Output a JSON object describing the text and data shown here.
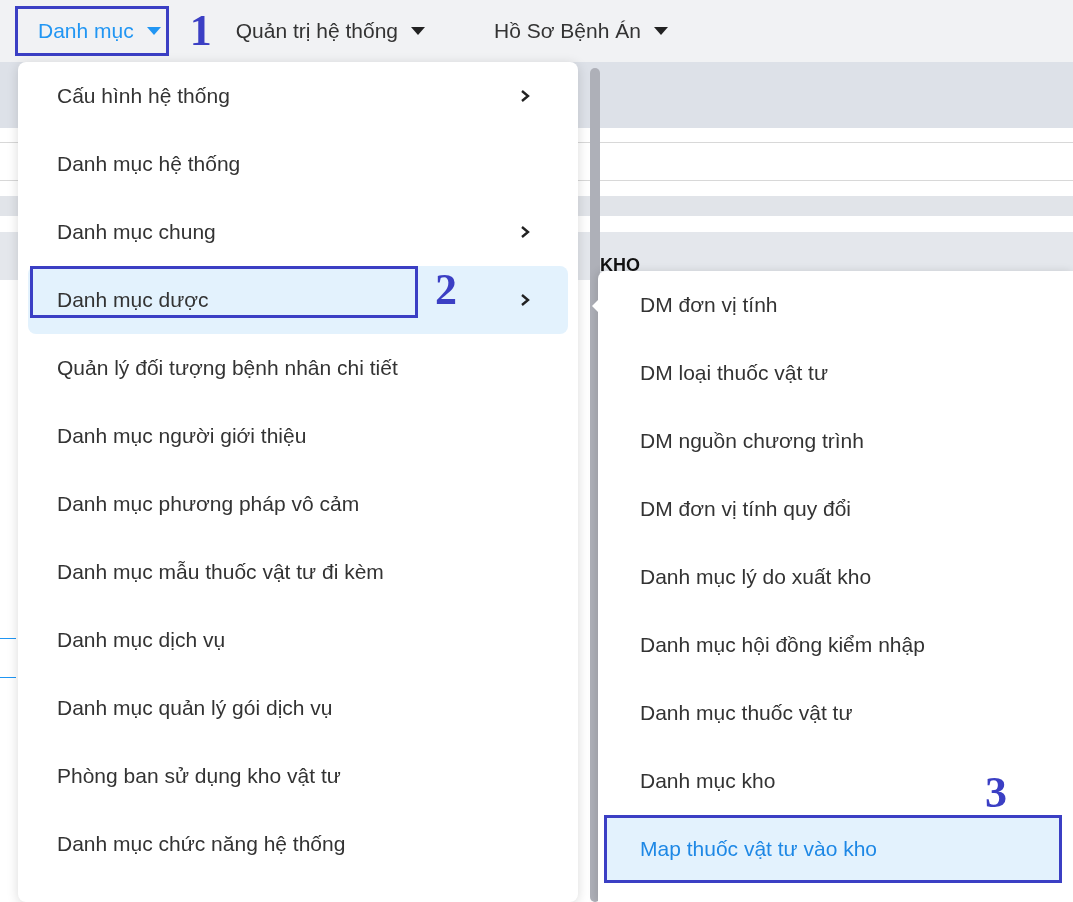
{
  "nav": [
    {
      "label": "Danh mục",
      "selected": true,
      "annotation": "1"
    },
    {
      "label": "Quản trị hệ thống",
      "selected": false
    },
    {
      "label": "Hồ Sơ Bệnh Án",
      "selected": false
    }
  ],
  "background": {
    "column_header": "KHO"
  },
  "menu": {
    "items": [
      {
        "label": "Cấu hình hệ thống",
        "has_submenu": true,
        "selected": false
      },
      {
        "label": "Danh mục hệ thống",
        "has_submenu": false,
        "selected": false
      },
      {
        "label": "Danh mục chung",
        "has_submenu": true,
        "selected": false
      },
      {
        "label": "Danh mục dược",
        "has_submenu": true,
        "selected": true,
        "annotation": "2"
      },
      {
        "label": "Quản lý đối tượng bệnh nhân chi tiết",
        "has_submenu": false,
        "selected": false
      },
      {
        "label": "Danh mục người giới thiệu",
        "has_submenu": false,
        "selected": false
      },
      {
        "label": "Danh mục phương pháp vô cảm",
        "has_submenu": false,
        "selected": false
      },
      {
        "label": "Danh mục mẫu thuốc vật tư đi kèm",
        "has_submenu": false,
        "selected": false
      },
      {
        "label": "Danh mục dịch vụ",
        "has_submenu": false,
        "selected": false
      },
      {
        "label": "Danh mục quản lý gói dịch vụ",
        "has_submenu": false,
        "selected": false
      },
      {
        "label": "Phòng ban sử dụng kho vật tư",
        "has_submenu": false,
        "selected": false
      },
      {
        "label": "Danh mục chức năng hệ thống",
        "has_submenu": false,
        "selected": false
      }
    ]
  },
  "submenu": {
    "items": [
      {
        "label": "DM đơn vị tính",
        "selected": false
      },
      {
        "label": "DM loại thuốc vật tư",
        "selected": false
      },
      {
        "label": "DM nguồn chương trình",
        "selected": false
      },
      {
        "label": "DM đơn vị tính quy đổi",
        "selected": false
      },
      {
        "label": "Danh mục lý do xuất kho",
        "selected": false
      },
      {
        "label": "Danh mục hội đồng kiểm nhập",
        "selected": false
      },
      {
        "label": "Danh mục thuốc vật tư",
        "selected": false
      },
      {
        "label": "Danh mục kho",
        "selected": false
      },
      {
        "label": "Map thuốc vật tư vào kho",
        "selected": true,
        "annotation": "3"
      }
    ]
  }
}
